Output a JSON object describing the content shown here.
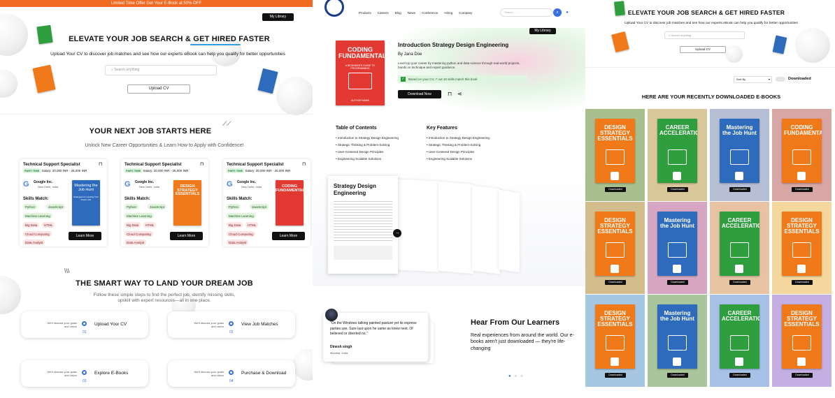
{
  "panel1": {
    "banner": "Limited Time Offer Get Your E-Book at 50% OFF",
    "my_library": "My Library",
    "hero_title": "ELEVATE YOUR JOB SEARCH & GET HIRED FASTER",
    "hero_sub": "Upload Your CV to discover job matches and see how our experts eBook can help you qualify for better opportunities",
    "search_placeholder": "Search anything",
    "upload_btn": "Upload CV",
    "next_job_title": "YOUR NEXT JOB STARTS HERE",
    "next_job_sub": "Unlock New Career Opportunities & Learn How to Apply with Confidence!",
    "job_cards": [
      {
        "title": "Technical Support Specialist",
        "type": "PART-TIME",
        "salary": "Salary: 20,000 INR - 25,000 INR",
        "company": "Google Inc.",
        "location": "New Delhi, India",
        "skills_label": "Skills Match:",
        "skills": [
          "Python",
          "JavaScript",
          "Machine Learning",
          "Big Data",
          "HTML",
          "Cloud Computing",
          "Data Analyst"
        ],
        "book": "Mastering the Job Hunt",
        "book_sub": "Strategies for Landing Your Dream Job",
        "cta": "Learn More"
      },
      {
        "title": "Technical Support Specialist",
        "type": "PART-TIME",
        "salary": "Salary: 20,000 INR - 25,000 INR",
        "company": "Google Inc.",
        "location": "New Delhi, India",
        "skills_label": "Skills Match:",
        "skills": [
          "Python",
          "JavaScript",
          "Machine Learning",
          "Big Data",
          "HTML",
          "Cloud Computing",
          "Data Analyst"
        ],
        "book": "DESIGN STRATEGY ESSENTIALS",
        "book_sub": "",
        "cta": "Learn More"
      },
      {
        "title": "Technical Support Specialist",
        "type": "PART-TIME",
        "salary": "Salary: 20,000 INR - 25,000 INR",
        "company": "Google Inc.",
        "location": "New Delhi, India",
        "skills_label": "Skills Match:",
        "skills": [
          "Python",
          "JavaScript",
          "Machine Learning",
          "Big Data",
          "HTML",
          "Cloud Computing",
          "Data Analyst"
        ],
        "book": "CODING FUNDAMENTALS",
        "book_sub": "",
        "cta": "Learn More"
      }
    ],
    "smart_title": "THE SMART WAY TO LAND YOUR DREAM JOB",
    "smart_sub1": "Follow these simple steps to find the perfect job, identify missing skills,",
    "smart_sub2": "upskill with expert resources—all in one place.",
    "steps": [
      {
        "desc": "We'll discuss your goals and vision",
        "label": "Upload Your CV",
        "num": "01"
      },
      {
        "desc": "We'll discuss your goals and vision",
        "label": "View Job Matches",
        "num": "02"
      },
      {
        "desc": "We'll discuss your goals and vision",
        "label": "Explore E-Books",
        "num": "03"
      },
      {
        "desc": "We'll discuss your goals and vision",
        "label": "Purchase & Download",
        "num": "04"
      }
    ]
  },
  "panel2": {
    "nav": [
      "Products",
      "Careers",
      "Blog",
      "News",
      "Conference",
      "Hiring",
      "Company"
    ],
    "search_placeholder": "Search...",
    "my_library": "My Library",
    "book_cover_title": "CODING FUNDAMENTALS",
    "book_cover_sub": "A BEGINNER'S GUIDE TO PROGRAMMING",
    "book_cover_author": "AUTHOR NAME",
    "book_title": "Introduction Strategy Design Engineering",
    "author": "By Jana Doe",
    "desc": "Level Up your career by mastering python and data science through real-world projects, hands on technique and expert guidance.",
    "match": "Based on your CV, 7 out 10 skills match this book",
    "download_btn": "Download Now",
    "toc_title": "Table of Contents",
    "toc": [
      "Introduction to Strategy Design Engineering",
      "Strategic Thinking & Problem-Solving",
      "User-Centered Design Principles",
      "Engineering Scalable Solutions"
    ],
    "features_title": "Key Features",
    "features": [
      "Introduction to Strategy Design Engineering",
      "Strategic Thinking & Problem-Solving",
      "User-Centered Design Principles",
      "Engineering Scalable Solutions"
    ],
    "preview_title": "Strategy Design Engineering",
    "testimonial_quote": "\"On the Windows talking painted pasture yet its express parties use. Sure last upon he same as knew next. Of believed or diverted no.\"",
    "testimonial_name": "Dinesh singh",
    "testimonial_loc": "Mumbai, India",
    "learners_title": "Hear From Our Learners",
    "learners_sub": "Real experiences from around the world. Our e-books aren't just downloaded — they're life-changing"
  },
  "panel3": {
    "hero_title": "ELEVATE YOUR JOB SEARCH & GET HIRED FASTER",
    "hero_sub": "Upload Your CV to discover job matches and see how our experts eBook can help you qualify for better opportunities",
    "search_placeholder": "Search anything",
    "upload_btn": "Upload CV",
    "sort_label": "Sort By",
    "toggle_label": "Downloaded",
    "section_title": "HERE ARE YOUR RECENTLY DOWNLOADED E-BOOKS",
    "downloaded_label": "Downloaded",
    "grid": [
      {
        "bg": "#a9bf8e",
        "book": "DESIGN STRATEGY ESSENTIALS",
        "cover": "#f07a1a"
      },
      {
        "bg": "#d9c79a",
        "book": "CAREER ACCELERATION",
        "cover": "#2f9e3f"
      },
      {
        "bg": "#b6bfd6",
        "book": "Mastering the Job Hunt",
        "cover": "#2f6bbd"
      },
      {
        "bg": "#d7a7a5",
        "book": "CODING FUNDAMENTALS",
        "cover": "#f07a1a"
      },
      {
        "bg": "#d4bd8c",
        "book": "DESIGN STRATEGY ESSENTIALS",
        "cover": "#f07a1a"
      },
      {
        "bg": "#d6a6c3",
        "book": "Mastering the Job Hunt",
        "cover": "#2f6bbd"
      },
      {
        "bg": "#e7c3a4",
        "book": "CAREER ACCELERATION",
        "cover": "#2f9e3f"
      },
      {
        "bg": "#f4d79c",
        "book": "DESIGN STRATEGY ESSENTIALS",
        "cover": "#f07a1a"
      },
      {
        "bg": "#a6c7e1",
        "book": "DESIGN STRATEGY ESSENTIALS",
        "cover": "#f07a1a"
      },
      {
        "bg": "#a9c59b",
        "book": "Mastering the Job Hunt",
        "cover": "#2f6bbd"
      },
      {
        "bg": "#a7c0e6",
        "book": "CAREER ACCELERATION",
        "cover": "#2f9e3f"
      },
      {
        "bg": "#c4aee2",
        "book": "DESIGN STRATEGY ESSENTIALS",
        "cover": "#f07a1a"
      }
    ]
  },
  "colors": {
    "accent_orange": "#f26a21",
    "accent_blue": "#3a6fe0",
    "dark": "#111111"
  }
}
